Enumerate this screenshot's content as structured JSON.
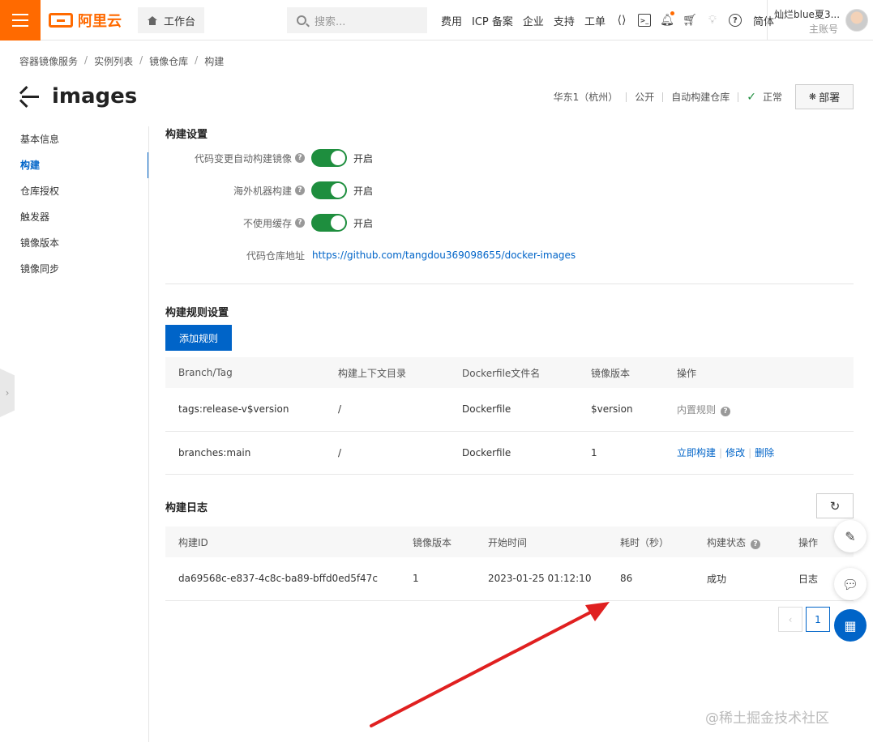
{
  "topbar": {
    "brand": "阿里云",
    "workbench": "工作台",
    "search_placeholder": "搜索...",
    "links": [
      "费用",
      "ICP 备案",
      "企业",
      "支持",
      "工单"
    ],
    "icons": [
      "code-icon",
      "terminal-icon",
      "bell-icon",
      "cart-icon",
      "bulb-icon",
      "help-icon"
    ],
    "lang": "简体",
    "user_name": "灿烂blue夏3...",
    "user_role": "主账号"
  },
  "breadcrumb": [
    "容器镜像服务",
    "实例列表",
    "镜像仓库",
    "构建"
  ],
  "page": {
    "title": "images",
    "region": "华东1（杭州）",
    "visibility": "公开",
    "repo_type": "自动构建仓库",
    "status": "正常",
    "deploy_label": "部署"
  },
  "sidenav": [
    "基本信息",
    "构建",
    "仓库授权",
    "触发器",
    "镜像版本",
    "镜像同步"
  ],
  "build_settings": {
    "title": "构建设置",
    "rows": [
      {
        "label": "代码变更自动构建镜像",
        "state": "开启"
      },
      {
        "label": "海外机器构建",
        "state": "开启"
      },
      {
        "label": "不使用缓存",
        "state": "开启"
      }
    ],
    "repo_label": "代码仓库地址",
    "repo_url": "https://github.com/tangdou369098655/docker-images"
  },
  "build_rules": {
    "title": "构建规则设置",
    "add_button": "添加规则",
    "columns": [
      "Branch/Tag",
      "构建上下文目录",
      "Dockerfile文件名",
      "镜像版本",
      "操作"
    ],
    "rows": [
      {
        "ref": "tags:release-v$version",
        "context": "/",
        "dockerfile": "Dockerfile",
        "version": "$version",
        "op_text": "内置规则"
      },
      {
        "ref": "branches:main",
        "context": "/",
        "dockerfile": "Dockerfile",
        "version": "1",
        "ops": [
          "立即构建",
          "修改",
          "删除"
        ]
      }
    ]
  },
  "build_log": {
    "title": "构建日志",
    "columns": [
      "构建ID",
      "镜像版本",
      "开始时间",
      "耗时（秒）",
      "构建状态",
      "操作"
    ],
    "rows": [
      {
        "id": "da69568c-e837-4c8c-ba89-bffd0ed5f47c",
        "version": "1",
        "start": "2023-01-25 01:12:10",
        "duration": "86",
        "status": "成功",
        "op": "日志"
      }
    ],
    "page_current": "1"
  },
  "watermark": "@稀土掘金技术社区",
  "colors": {
    "brand": "#ff6a00",
    "primary": "#0064c8",
    "success": "#1e8e3e",
    "annotation_arrow": "#e02020"
  }
}
